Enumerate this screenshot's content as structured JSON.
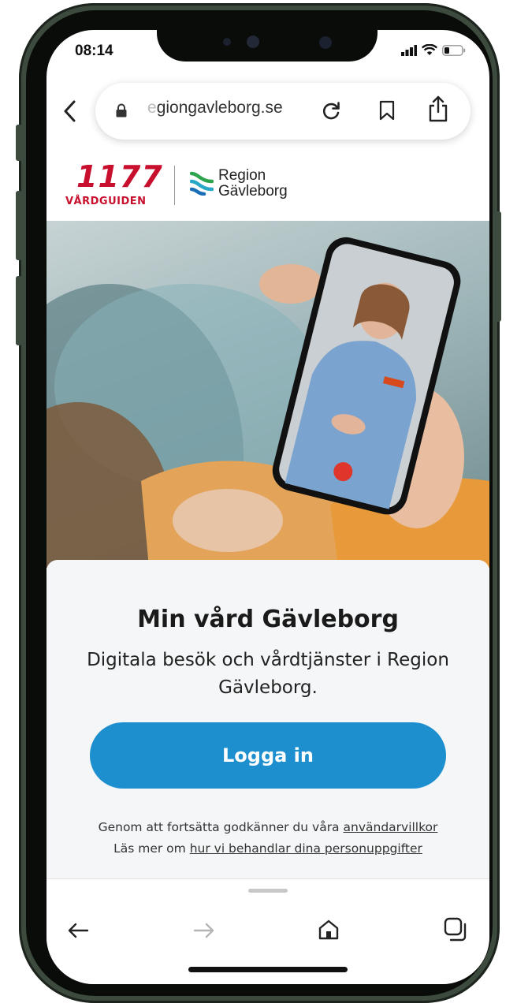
{
  "status_bar": {
    "time": "08:14"
  },
  "browser": {
    "url_visible_fade": "e",
    "url_visible": "giongavleborg.se"
  },
  "header": {
    "logo_1177_number": "1177",
    "logo_1177_text": "VÅRDGUIDEN",
    "region_line1": "Region",
    "region_line2": "Gävleborg"
  },
  "main": {
    "title": "Min vård Gävleborg",
    "subtitle": "Digitala besök och vårdtjänster i Region Gävleborg.",
    "login_label": "Logga in",
    "legal_line1_prefix": "Genom att fortsätta godkänner du våra",
    "terms_link": "användarvillkor",
    "legal_line2_prefix": "Läs mer om",
    "privacy_link": "hur vi behandlar dina personuppgifter"
  },
  "colors": {
    "brand_red": "#c8102e",
    "login_blue": "#1d8fcf",
    "region_green": "#2ea44f",
    "region_blue": "#1a6fb8"
  },
  "icons": {
    "back": "chevron-left-icon",
    "lock": "lock-icon",
    "reload": "reload-icon",
    "bookmark": "bookmark-icon",
    "share": "share-icon",
    "nav_back": "arrow-left-icon",
    "nav_forward": "arrow-right-icon",
    "home": "home-icon",
    "tabs": "tabs-icon"
  }
}
